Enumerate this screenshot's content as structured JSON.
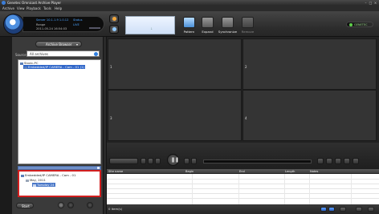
{
  "window": {
    "title": "Genetec Omnicast Archive Player"
  },
  "menu": {
    "items": [
      "Archive",
      "View",
      "Playback",
      "Tools",
      "Help"
    ]
  },
  "info_panel": {
    "line1": "Server 10.1.1.9 1.0.12",
    "line2": "Range",
    "line3": "Status",
    "line4": "2011-05-24 16:54:03",
    "line5": "LIVE"
  },
  "toolbar": {
    "tools": [
      {
        "label": "Pattern",
        "state": "active"
      },
      {
        "label": "Expand",
        "state": "normal"
      },
      {
        "label": "Synchronize",
        "state": "normal"
      },
      {
        "label": "Remove",
        "state": "disabled"
      }
    ],
    "brand_text": "GENETEC"
  },
  "left_panel": {
    "archive_browser_label": "Archive Browser",
    "search_label": "Source",
    "search_value": "All archives",
    "tree": [
      {
        "label": "Slovic-PC",
        "level": 0
      },
      {
        "label": "Embedded/IP CAMERA - Cam - 01 (1)",
        "level": 1,
        "selected": true
      }
    ],
    "calendar": [
      {
        "label": "Embedded/IP CAMERA - Cam - 01",
        "level": 0
      },
      {
        "label": "May, 2011",
        "level": 1
      },
      {
        "label": "Tuesday 24",
        "level": 2,
        "selected": true
      }
    ],
    "start_label": "Start"
  },
  "video_tiles": [
    {
      "number": "1"
    },
    {
      "number": "2"
    },
    {
      "number": "3"
    },
    {
      "number": "4"
    }
  ],
  "results_table": {
    "columns": [
      "Site name",
      "Begin",
      "End",
      "Length",
      "Notes"
    ]
  },
  "status": {
    "items_label": "0 item(s)"
  },
  "colors": {
    "selection_blue": "#2f66c9",
    "highlight_red": "#d21f1f",
    "brand_green": "#5fd24a"
  }
}
